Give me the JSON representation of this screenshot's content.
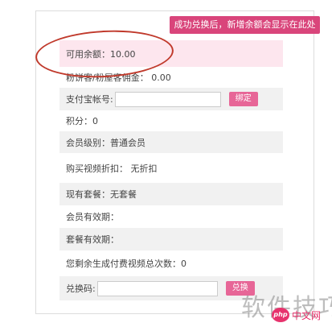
{
  "tooltip": "成功兑换后，新增余额会显示在此处",
  "rows": {
    "balance": "可用余额：10.00",
    "fans_commission": "粉饼客/粉屋客佣金：  0.00",
    "alipay_label": "支付宝帐号:",
    "alipay_button": "绑定",
    "points": "积分：0",
    "member_level": "会员级别：普通会员",
    "video_discount": "购买视频折扣：  无折扣",
    "current_plan": "现有套餐：无套餐",
    "member_validity": "会员有效期：",
    "plan_validity": "套餐有效期：",
    "remaining_count": "您剩余生成付费视频总次数：0",
    "redeem_label": "兑换码:",
    "redeem_button": "兑换"
  },
  "watermark": {
    "text": "软件技巧",
    "logo_php": "php",
    "logo_site": "中文网"
  },
  "colors": {
    "tooltip_bg": "#d9457b",
    "button_bg": "#e76697",
    "highlight_row": "#fde6ee",
    "annotation": "#c0392b"
  }
}
